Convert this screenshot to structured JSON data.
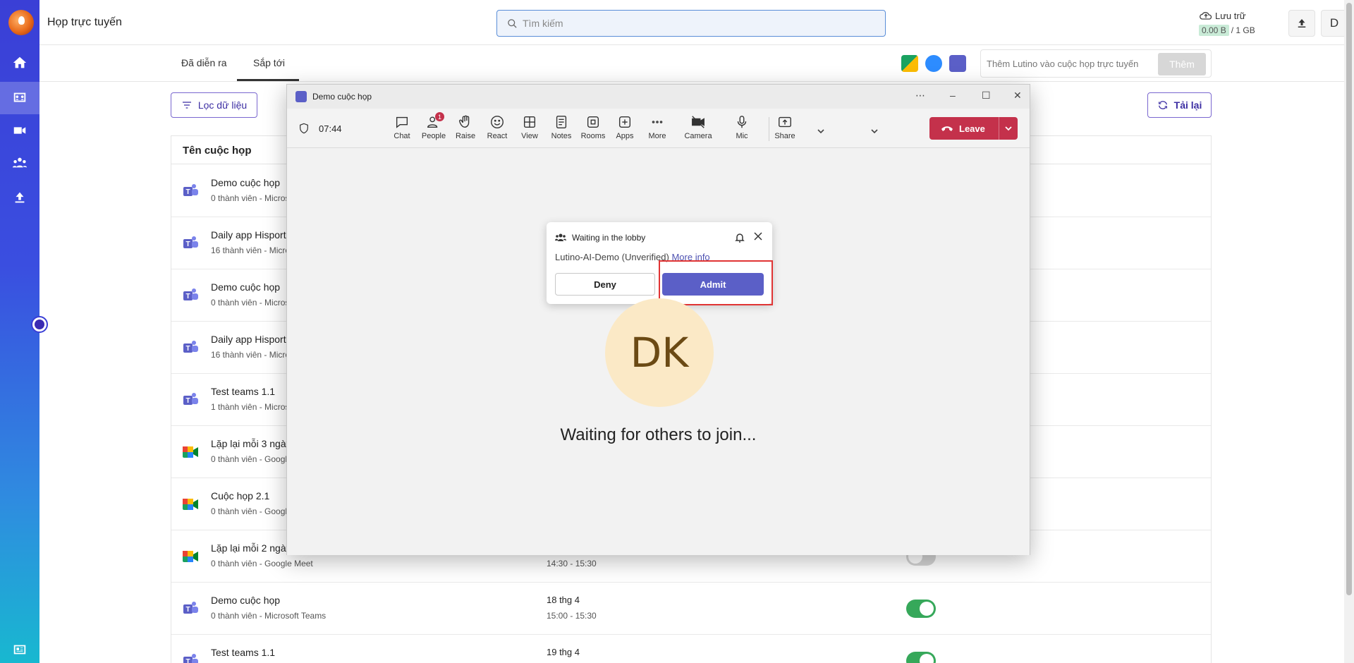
{
  "app": {
    "title": "Họp trực tuyến",
    "search_placeholder": "Tìm kiếm",
    "storage": {
      "label": "Lưu trữ",
      "used": "0.00 B",
      "total": "/ 1 GB"
    },
    "avatar_letter": "D"
  },
  "sidebar": {
    "items": [
      {
        "name": "home",
        "icon": "home-icon"
      },
      {
        "name": "meetings",
        "icon": "meeting-icon",
        "active": true
      },
      {
        "name": "video",
        "icon": "video-icon"
      },
      {
        "name": "groups",
        "icon": "group-icon"
      },
      {
        "name": "upload",
        "icon": "upload-icon"
      },
      {
        "name": "profile-card",
        "icon": "id-card-icon"
      }
    ]
  },
  "tabs": [
    {
      "label": "Đã diễn ra",
      "active": false
    },
    {
      "label": "Sắp tới",
      "active": true
    }
  ],
  "lutino": {
    "placeholder": "Thêm Lutino vào cuộc họp trực tuyến",
    "add_label": "Thêm"
  },
  "toolbar": {
    "filter_label": "Lọc dữ liệu",
    "reload_label": "Tải lại"
  },
  "table": {
    "header": "Tên cuộc họp",
    "rows": [
      {
        "title": "Demo cuộc họp",
        "subtitle": "0 thành viên - Micros",
        "platform": "teams",
        "date": "",
        "time": "",
        "enabled": null
      },
      {
        "title": "Daily app Hisport",
        "subtitle": "16 thành viên - Micro",
        "platform": "teams",
        "date": "",
        "time": "",
        "enabled": null
      },
      {
        "title": "Demo cuộc họp",
        "subtitle": "0 thành viên - Micros",
        "platform": "teams",
        "date": "",
        "time": "",
        "enabled": null
      },
      {
        "title": "Daily app Hisport",
        "subtitle": "16 thành viên - Micro",
        "platform": "teams",
        "date": "",
        "time": "",
        "enabled": null
      },
      {
        "title": "Test teams 1.1",
        "subtitle": "1 thành viên - Micros",
        "platform": "teams",
        "date": "",
        "time": "",
        "enabled": null
      },
      {
        "title": "Lặp lại mỗi 3 ngày",
        "subtitle": "0 thành viên - Google",
        "platform": "meet",
        "date": "",
        "time": "",
        "enabled": null
      },
      {
        "title": "Cuộc họp 2.1",
        "subtitle": "0 thành viên - Google",
        "platform": "meet",
        "date": "",
        "time": "",
        "enabled": null
      },
      {
        "title": "Lặp lại mỗi 2 ngày",
        "subtitle": "0 thành viên - Google Meet",
        "platform": "meet",
        "date": "",
        "time": "14:30 - 15:30",
        "enabled": false
      },
      {
        "title": "Demo cuộc họp",
        "subtitle": "0 thành viên - Microsoft Teams",
        "platform": "teams",
        "date": "18 thg 4",
        "time": "15:00 - 15:30",
        "enabled": true
      },
      {
        "title": "Test teams 1.1",
        "subtitle": "1 thành viên - Microsoft Teams",
        "platform": "teams",
        "date": "19 thg 4",
        "time": "",
        "enabled": true
      }
    ]
  },
  "teams_window": {
    "title": "Demo cuộc họp",
    "timer": "07:44",
    "buttons": [
      {
        "label": "Chat",
        "icon": "chat-icon"
      },
      {
        "label": "People",
        "icon": "people-icon",
        "badge": "1"
      },
      {
        "label": "Raise",
        "icon": "raise-hand-icon"
      },
      {
        "label": "React",
        "icon": "react-icon"
      },
      {
        "label": "View",
        "icon": "view-icon"
      },
      {
        "label": "Notes",
        "icon": "notes-icon"
      },
      {
        "label": "Rooms",
        "icon": "rooms-icon"
      },
      {
        "label": "Apps",
        "icon": "apps-icon"
      },
      {
        "label": "More",
        "icon": "more-icon"
      },
      {
        "label": "Camera",
        "icon": "camera-off-icon"
      },
      {
        "label": "Mic",
        "icon": "mic-icon"
      },
      {
        "label": "Share",
        "icon": "share-icon"
      }
    ],
    "leave_label": "Leave",
    "lobby": {
      "title": "Waiting in the lobby",
      "person": "Lutino-AI-Demo (Unverified)",
      "more_info": "More info",
      "deny_label": "Deny",
      "admit_label": "Admit"
    },
    "avatar_initials": "DK",
    "waiting_text": "Waiting for others to join..."
  },
  "colors": {
    "accent": "#3c2ea3",
    "teams_purple": "#5b5fc7",
    "leave_red": "#c4314b",
    "toggle_on": "#36a85a"
  }
}
